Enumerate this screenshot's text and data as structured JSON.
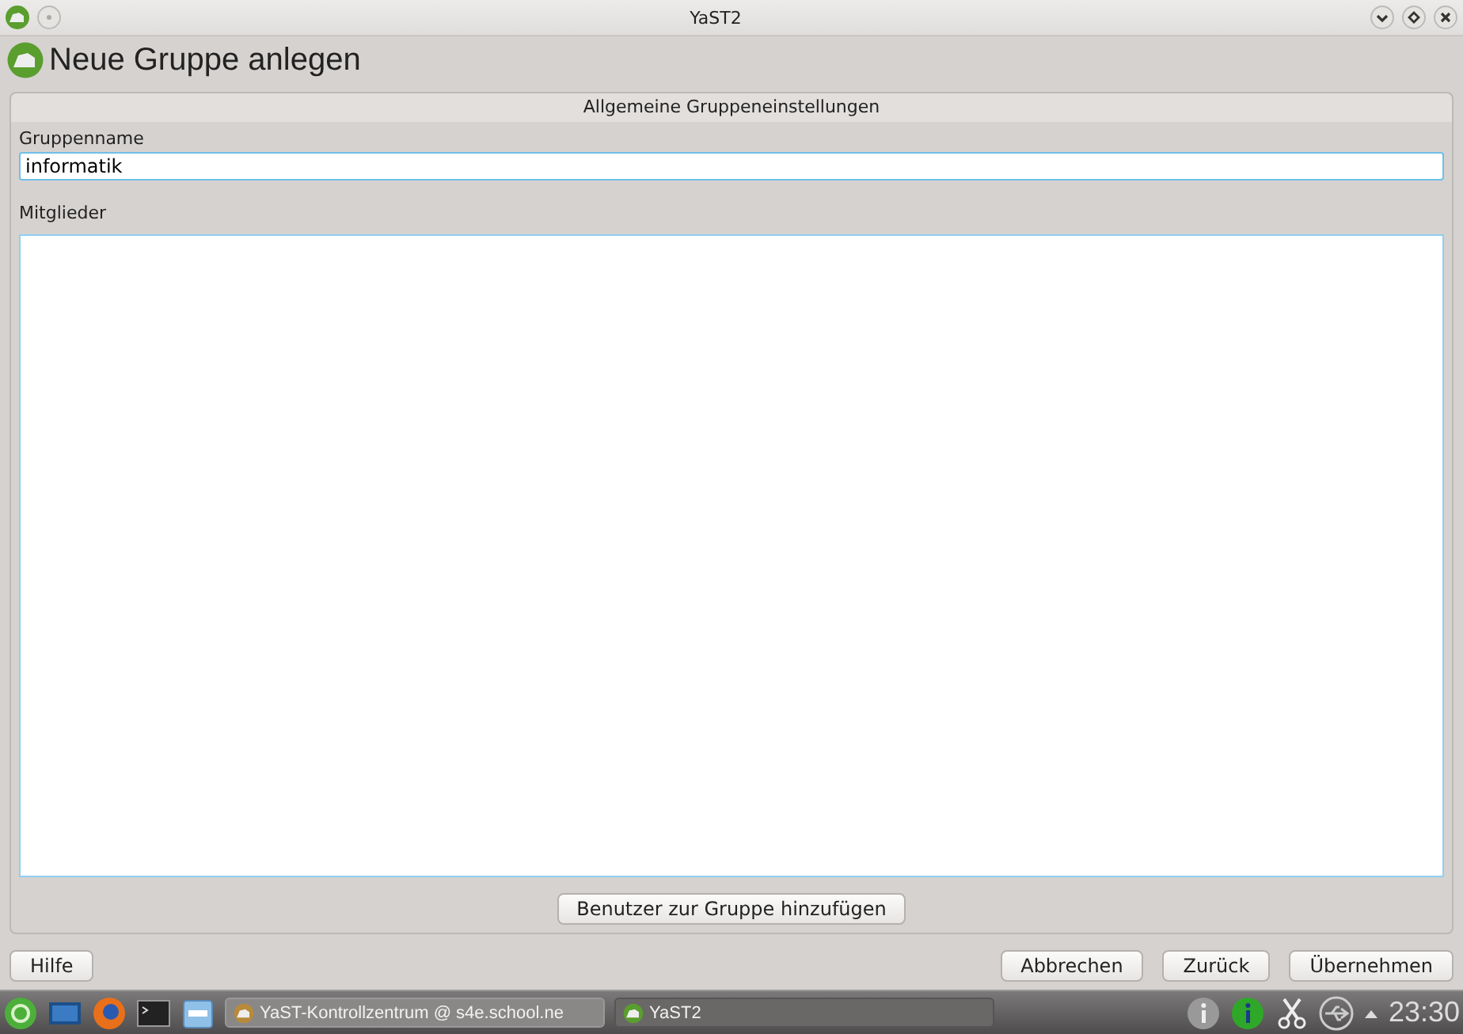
{
  "window": {
    "title": "YaST2"
  },
  "heading": "Neue Gruppe anlegen",
  "frame": {
    "title": "Allgemeine Gruppeneinstellungen",
    "group_name": {
      "label": "Gruppenname",
      "value": "informatik"
    },
    "members": {
      "label": "Mitglieder"
    },
    "add_button": "Benutzer zur Gruppe hinzufügen"
  },
  "buttons": {
    "help": "Hilfe",
    "cancel": "Abbrechen",
    "back": "Zurück",
    "accept": "Übernehmen"
  },
  "taskbar": {
    "tasks": [
      {
        "label": "YaST-Kontrollzentrum @ s4e.school.ne",
        "selected": false
      },
      {
        "label": "YaST2",
        "selected": true
      }
    ],
    "clock": "23:30"
  }
}
